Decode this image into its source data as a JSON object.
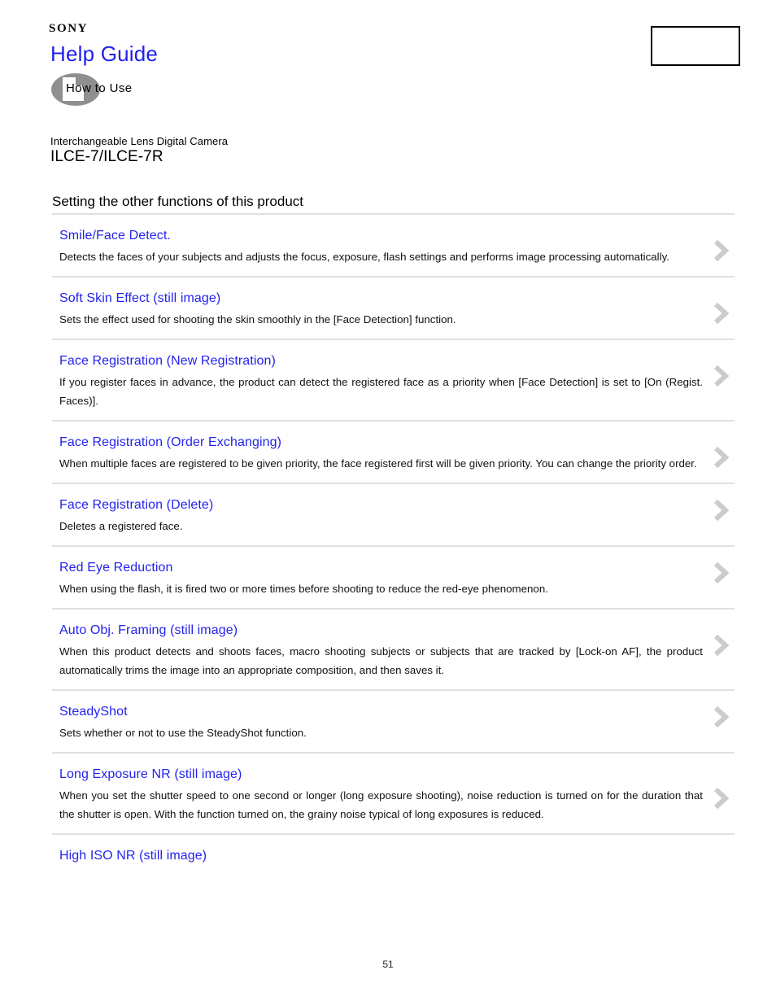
{
  "header": {
    "brand": "SONY",
    "title": "Help Guide",
    "how_to_use_label": "How to Use",
    "how_to_use_icon": "book-page-icon",
    "corner_box_label": ""
  },
  "product": {
    "kind": "Interchangeable Lens Digital Camera",
    "model": "ILCE-7/ILCE-7R"
  },
  "section": {
    "title": "Setting the other functions of this product"
  },
  "entries": [
    {
      "title": "Smile/Face Detect.",
      "description": "Detects the faces of your subjects and adjusts the focus, exposure, flash settings and performs image processing automatically.",
      "chevron": "chevron-right-icon"
    },
    {
      "title": "Soft Skin Effect (still image)",
      "description": "Sets the effect used for shooting the skin smoothly in the [Face Detection] function.",
      "chevron": "chevron-right-icon"
    },
    {
      "title": "Face Registration (New Registration)",
      "description": "If you register faces in advance, the product can detect the registered face as a priority when [Face Detection] is set to [On (Regist. Faces)].",
      "chevron": "chevron-right-icon"
    },
    {
      "title": "Face Registration (Order Exchanging)",
      "description": "When multiple faces are registered to be given priority, the face registered first will be given priority. You can change the priority order.",
      "chevron": "chevron-right-icon"
    },
    {
      "title": "Face Registration (Delete)",
      "description": "Deletes a registered face.",
      "chevron": "chevron-right-icon"
    },
    {
      "title": "Red Eye Reduction",
      "description": "When using the flash, it is fired two or more times before shooting to reduce the red-eye phenomenon.",
      "chevron": "chevron-right-icon"
    },
    {
      "title": "Auto Obj. Framing (still image)",
      "description": "When this product detects and shoots faces, macro shooting subjects or subjects that are tracked by [Lock-on AF], the product automatically trims the image into an appropriate composition, and then saves it.",
      "chevron": "chevron-right-icon"
    },
    {
      "title": "SteadyShot",
      "description": "Sets whether or not to use the SteadyShot function.",
      "chevron": "chevron-right-icon"
    },
    {
      "title": "Long Exposure NR (still image)",
      "description": "When you set the shutter speed to one second or longer (long exposure shooting), noise reduction is turned on for the duration that the shutter is open. With the function turned on, the grainy noise typical of long exposures is reduced.",
      "chevron": "chevron-right-icon"
    },
    {
      "title": "High ISO NR (still image)",
      "description": "",
      "chevron": ""
    }
  ],
  "footer": {
    "page_number": "51"
  },
  "colors": {
    "link": "#2323ee",
    "brand_title": "#2020ee",
    "divider": "#e0e0e0",
    "chevron": "#cccccc",
    "icon_gray": "#8f8f8f"
  }
}
